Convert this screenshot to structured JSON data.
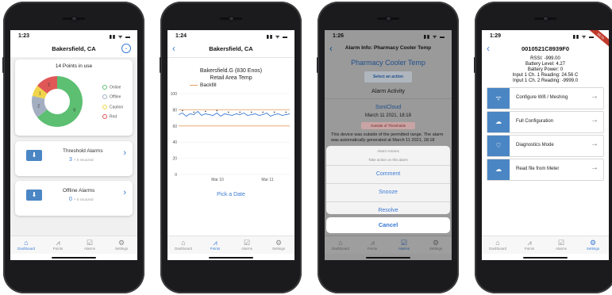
{
  "phone1": {
    "status_time": "1:23",
    "status_icons": "▮▮ ᯤ ▬",
    "nav_title": "Bakersfield, CA",
    "points_title": "14 Points in use",
    "donut": [
      {
        "label": "Online",
        "value": 9,
        "color": "#5cbf72"
      },
      {
        "label": "Offline",
        "value": 2,
        "color": "#a3afc1"
      },
      {
        "label": "Caution",
        "value": 1,
        "color": "#f0d54a"
      },
      {
        "label": "Red",
        "value": 2,
        "color": "#e05757"
      }
    ],
    "threshold": {
      "title": "Threshold Alarms",
      "count": "3",
      "snoozed": "+ 0 snoozed"
    },
    "offline": {
      "title": "Offline Alarms",
      "count": "0",
      "snoozed": "+ 0 snoozed"
    },
    "tabs": [
      "Dashboard",
      "Points",
      "Alarms",
      "Settings"
    ]
  },
  "phone2": {
    "status_time": "1:24",
    "status_icons": "▮▮ ᯤ ▬",
    "nav_title": "Bakersfield, CA",
    "chart_title": "Bakersfield.G (830 Enos)",
    "chart_subtitle": "Retail Area Temp",
    "legend_label": "Backfill",
    "pick_date": "Pick a Date",
    "tabs": [
      "Dashboard",
      "Points",
      "Alarms",
      "Settings"
    ]
  },
  "chart_data": {
    "type": "line",
    "title": "Bakersfield.G (830 Enos)",
    "subtitle": "Retail Area Temp",
    "y_ticks": [
      "100",
      "80",
      "60",
      "40",
      "20",
      "0"
    ],
    "ylim": [
      0,
      100
    ],
    "x_ticks": [
      "Mar 10",
      "Mar 11"
    ],
    "threshold_lines": [
      {
        "value": 80,
        "color": "#e8a060"
      },
      {
        "value": 60,
        "color": "#e8a060"
      }
    ],
    "series": [
      {
        "name": "Backfill",
        "color": "#3b7bd4",
        "y": [
          74,
          76,
          72,
          75,
          74,
          78,
          73,
          75,
          74,
          73,
          76,
          72,
          75,
          74,
          73,
          75,
          74,
          76,
          73,
          74,
          75,
          73,
          74,
          76,
          72,
          74,
          75,
          73,
          74,
          75
        ]
      }
    ]
  },
  "phone3": {
    "status_time": "1:26",
    "status_icons": "▮▮ ᯤ ▬",
    "nav_title": "Alarm Info: Pharmacy Cooler Temp",
    "heading": "Pharmacy Cooler Temp",
    "select_action": "Select an action",
    "activity": "Alarm Activity",
    "source": "SoniCloud",
    "date": "March 11 2021, 18:18",
    "badge": "Outside of Thresholds",
    "message": "This device was outside of the permitted range. The alarm was automatically generated at March 11 2021, 18:18",
    "sheet_title": "Alarm Actions",
    "sheet_sub": "Take action on this alarm",
    "actions": [
      "Comment",
      "Snooze",
      "Resolve"
    ],
    "cancel": "Cancel",
    "tabs": [
      "Dashboard",
      "Points",
      "Alarms",
      "Settings"
    ]
  },
  "phone4": {
    "status_time": "1:29",
    "status_icons": "▮▮ ᯤ ▬",
    "nav_title": "0010521C8939F0",
    "corner_ribbon": "BETA",
    "info": [
      "RSSI: -999.00",
      "Battery Level: 4.27",
      "Battery Power: 0",
      "Input 1 Ch. 1 Reading: 24.56 C",
      "Input 1 Ch. 2 Reading: -9999.0"
    ],
    "menu": [
      {
        "label": "Configure Wifi / Meshing",
        "icon": "wifi-icon"
      },
      {
        "label": "Full Configuration",
        "icon": "cloud-gear-icon"
      },
      {
        "label": "Diagnostics Mode",
        "icon": "heartbeat-icon"
      },
      {
        "label": "Read file from Meter",
        "icon": "cloud-download-icon"
      }
    ],
    "tabs": [
      "Dashboard",
      "Points",
      "Alarms",
      "Settings"
    ]
  }
}
